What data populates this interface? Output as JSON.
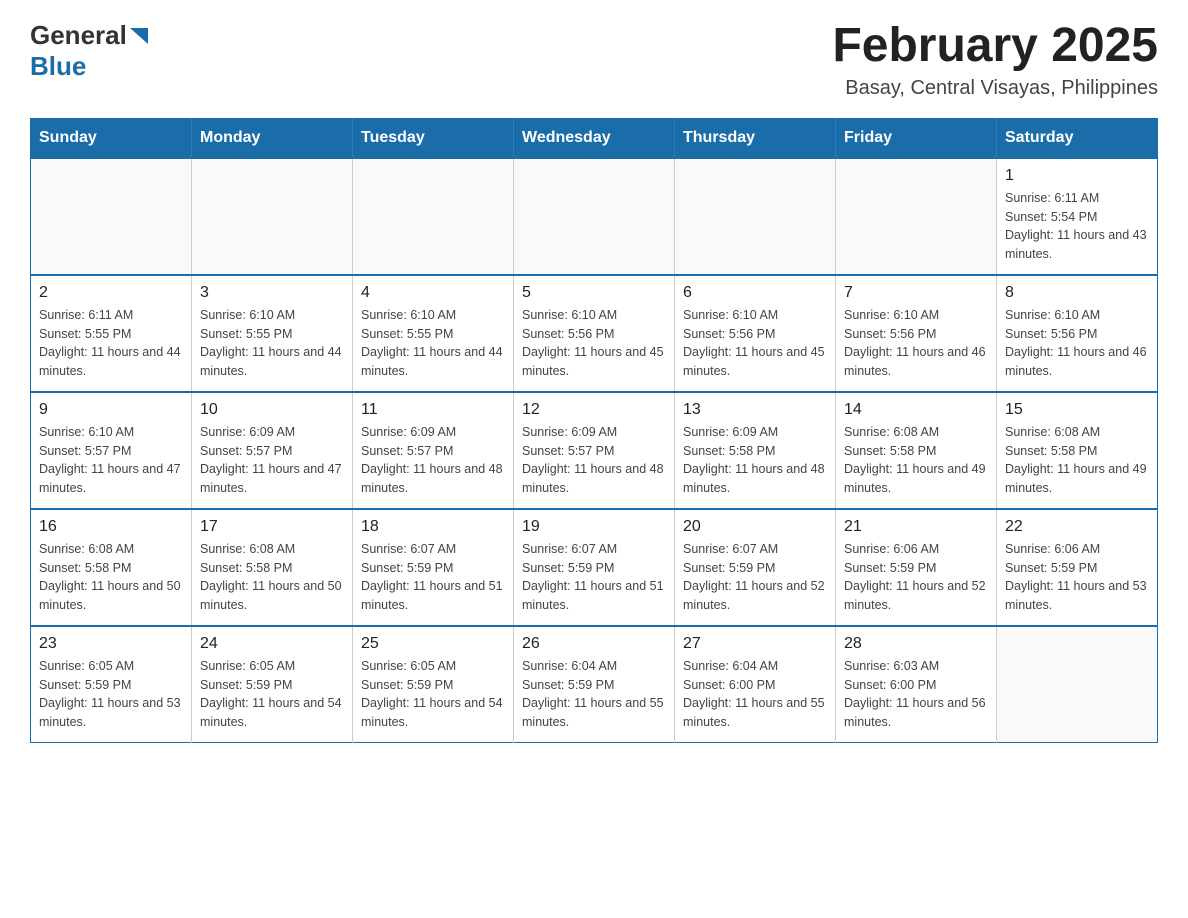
{
  "header": {
    "logo_general": "General",
    "logo_blue": "Blue",
    "title": "February 2025",
    "subtitle": "Basay, Central Visayas, Philippines"
  },
  "days_of_week": [
    "Sunday",
    "Monday",
    "Tuesday",
    "Wednesday",
    "Thursday",
    "Friday",
    "Saturday"
  ],
  "weeks": [
    [
      {
        "day": "",
        "info": ""
      },
      {
        "day": "",
        "info": ""
      },
      {
        "day": "",
        "info": ""
      },
      {
        "day": "",
        "info": ""
      },
      {
        "day": "",
        "info": ""
      },
      {
        "day": "",
        "info": ""
      },
      {
        "day": "1",
        "info": "Sunrise: 6:11 AM\nSunset: 5:54 PM\nDaylight: 11 hours and 43 minutes."
      }
    ],
    [
      {
        "day": "2",
        "info": "Sunrise: 6:11 AM\nSunset: 5:55 PM\nDaylight: 11 hours and 44 minutes."
      },
      {
        "day": "3",
        "info": "Sunrise: 6:10 AM\nSunset: 5:55 PM\nDaylight: 11 hours and 44 minutes."
      },
      {
        "day": "4",
        "info": "Sunrise: 6:10 AM\nSunset: 5:55 PM\nDaylight: 11 hours and 44 minutes."
      },
      {
        "day": "5",
        "info": "Sunrise: 6:10 AM\nSunset: 5:56 PM\nDaylight: 11 hours and 45 minutes."
      },
      {
        "day": "6",
        "info": "Sunrise: 6:10 AM\nSunset: 5:56 PM\nDaylight: 11 hours and 45 minutes."
      },
      {
        "day": "7",
        "info": "Sunrise: 6:10 AM\nSunset: 5:56 PM\nDaylight: 11 hours and 46 minutes."
      },
      {
        "day": "8",
        "info": "Sunrise: 6:10 AM\nSunset: 5:56 PM\nDaylight: 11 hours and 46 minutes."
      }
    ],
    [
      {
        "day": "9",
        "info": "Sunrise: 6:10 AM\nSunset: 5:57 PM\nDaylight: 11 hours and 47 minutes."
      },
      {
        "day": "10",
        "info": "Sunrise: 6:09 AM\nSunset: 5:57 PM\nDaylight: 11 hours and 47 minutes."
      },
      {
        "day": "11",
        "info": "Sunrise: 6:09 AM\nSunset: 5:57 PM\nDaylight: 11 hours and 48 minutes."
      },
      {
        "day": "12",
        "info": "Sunrise: 6:09 AM\nSunset: 5:57 PM\nDaylight: 11 hours and 48 minutes."
      },
      {
        "day": "13",
        "info": "Sunrise: 6:09 AM\nSunset: 5:58 PM\nDaylight: 11 hours and 48 minutes."
      },
      {
        "day": "14",
        "info": "Sunrise: 6:08 AM\nSunset: 5:58 PM\nDaylight: 11 hours and 49 minutes."
      },
      {
        "day": "15",
        "info": "Sunrise: 6:08 AM\nSunset: 5:58 PM\nDaylight: 11 hours and 49 minutes."
      }
    ],
    [
      {
        "day": "16",
        "info": "Sunrise: 6:08 AM\nSunset: 5:58 PM\nDaylight: 11 hours and 50 minutes."
      },
      {
        "day": "17",
        "info": "Sunrise: 6:08 AM\nSunset: 5:58 PM\nDaylight: 11 hours and 50 minutes."
      },
      {
        "day": "18",
        "info": "Sunrise: 6:07 AM\nSunset: 5:59 PM\nDaylight: 11 hours and 51 minutes."
      },
      {
        "day": "19",
        "info": "Sunrise: 6:07 AM\nSunset: 5:59 PM\nDaylight: 11 hours and 51 minutes."
      },
      {
        "day": "20",
        "info": "Sunrise: 6:07 AM\nSunset: 5:59 PM\nDaylight: 11 hours and 52 minutes."
      },
      {
        "day": "21",
        "info": "Sunrise: 6:06 AM\nSunset: 5:59 PM\nDaylight: 11 hours and 52 minutes."
      },
      {
        "day": "22",
        "info": "Sunrise: 6:06 AM\nSunset: 5:59 PM\nDaylight: 11 hours and 53 minutes."
      }
    ],
    [
      {
        "day": "23",
        "info": "Sunrise: 6:05 AM\nSunset: 5:59 PM\nDaylight: 11 hours and 53 minutes."
      },
      {
        "day": "24",
        "info": "Sunrise: 6:05 AM\nSunset: 5:59 PM\nDaylight: 11 hours and 54 minutes."
      },
      {
        "day": "25",
        "info": "Sunrise: 6:05 AM\nSunset: 5:59 PM\nDaylight: 11 hours and 54 minutes."
      },
      {
        "day": "26",
        "info": "Sunrise: 6:04 AM\nSunset: 5:59 PM\nDaylight: 11 hours and 55 minutes."
      },
      {
        "day": "27",
        "info": "Sunrise: 6:04 AM\nSunset: 6:00 PM\nDaylight: 11 hours and 55 minutes."
      },
      {
        "day": "28",
        "info": "Sunrise: 6:03 AM\nSunset: 6:00 PM\nDaylight: 11 hours and 56 minutes."
      },
      {
        "day": "",
        "info": ""
      }
    ]
  ]
}
